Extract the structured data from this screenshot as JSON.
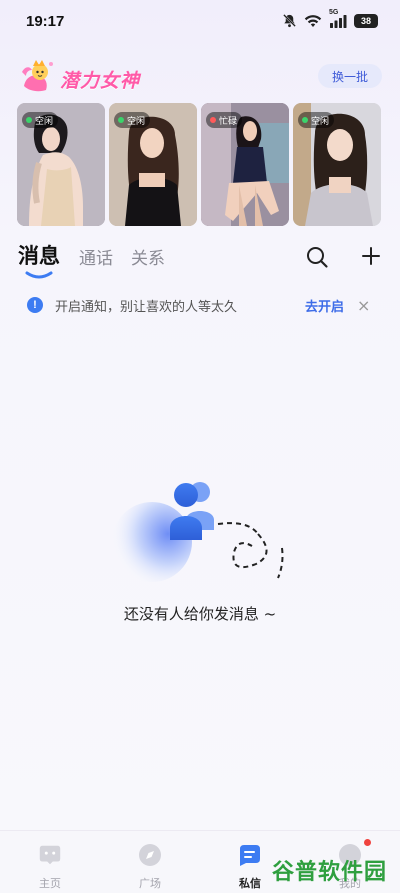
{
  "status_bar": {
    "time": "19:17",
    "network_label": "5G",
    "battery": "38"
  },
  "header": {
    "brand_title": "潜力女神",
    "refresh_label": "换一批"
  },
  "cards": [
    {
      "status": "空闲",
      "status_color": "#3ad46b"
    },
    {
      "status": "空闲",
      "status_color": "#3ad46b"
    },
    {
      "status": "忙碌",
      "status_color": "#ff5a5a"
    },
    {
      "status": "空闲",
      "status_color": "#3ad46b"
    }
  ],
  "tabs": [
    {
      "label": "消息",
      "active": true
    },
    {
      "label": "通话",
      "active": false
    },
    {
      "label": "关系",
      "active": false
    }
  ],
  "notice": {
    "text": "开启通知，别让喜欢的人等太久",
    "action_label": "去开启",
    "close_symbol": "×",
    "info_symbol": "!"
  },
  "empty_state": {
    "text": "还没有人给你发消息 ~"
  },
  "bottom_nav": [
    {
      "label": "主页",
      "icon": "home-icon",
      "active": false
    },
    {
      "label": "广场",
      "icon": "compass-icon",
      "active": false
    },
    {
      "label": "私信",
      "icon": "message-icon",
      "active": true
    },
    {
      "label": "我的",
      "icon": "profile-icon",
      "active": false
    }
  ],
  "watermark": {
    "text": "谷普软件园"
  },
  "colors": {
    "accent": "#3d6ce8",
    "brand_pink": "#ff5aa8",
    "notification_dot": "#f0433e"
  }
}
